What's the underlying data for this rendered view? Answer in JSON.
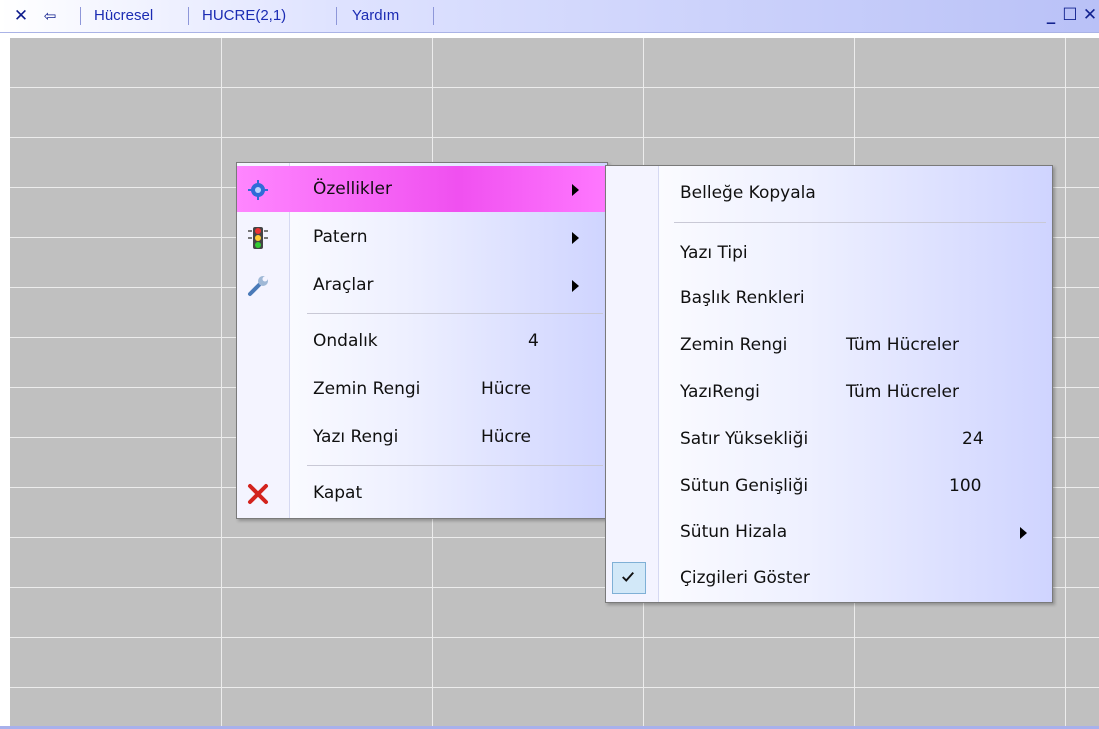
{
  "titlebar": {
    "close_icon": "close-x-icon",
    "back_icon": "back-arrow-icon",
    "menus": [
      "Hücresel",
      "HUCRE(2,1)",
      "Yardım"
    ],
    "window_buttons": [
      "minimize-icon",
      "maximize-icon",
      "close-icon"
    ]
  },
  "context_menu": {
    "items": [
      {
        "label": "Özellikler",
        "icon": "gear-icon",
        "has_submenu": true,
        "highlighted": true
      },
      {
        "label": "Patern",
        "icon": "traffic-light-icon",
        "has_submenu": true
      },
      {
        "label": "Araçlar",
        "icon": "wrench-icon",
        "has_submenu": true
      },
      {
        "label": "Ondalık",
        "value": "4"
      },
      {
        "label": "Zemin Rengi",
        "value": "Hücre"
      },
      {
        "label": "Yazı Rengi",
        "value": "Hücre"
      },
      {
        "label": "Kapat",
        "icon": "red-x-icon"
      }
    ]
  },
  "submenu": {
    "items": [
      {
        "label": "Belleğe Kopyala"
      },
      {
        "label": "Yazı Tipi"
      },
      {
        "label": "Başlık Renkleri"
      },
      {
        "label": "Zemin Rengi",
        "value": "Tüm Hücreler"
      },
      {
        "label": "YazıRengi",
        "value": "Tüm Hücreler"
      },
      {
        "label": "Satır Yüksekliği",
        "value": "24"
      },
      {
        "label": "Sütun Genişliği",
        "value": "100"
      },
      {
        "label": "Sütun Hizala",
        "has_submenu": true
      },
      {
        "label": "Çizgileri Göster",
        "checked": true
      }
    ]
  },
  "colors": {
    "grid_bg": "#c0c0c0",
    "grid_lines": "#ececec",
    "highlight": "#f050f0",
    "menu_text_blue": "#1b2bb3"
  }
}
